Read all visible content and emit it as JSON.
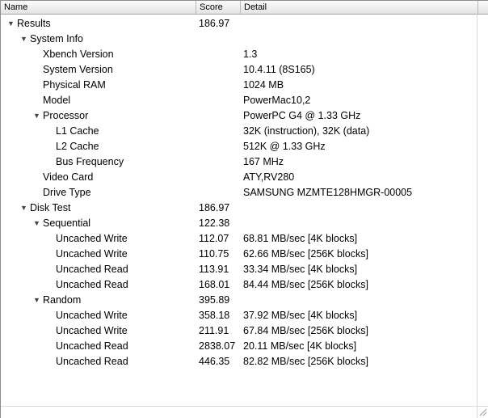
{
  "columns": {
    "name": "Name",
    "score": "Score",
    "detail": "Detail"
  },
  "rows": [
    {
      "name": "Results",
      "score": "186.97",
      "detail": "",
      "expanded": true
    },
    {
      "name": "System Info",
      "score": "",
      "detail": "",
      "expanded": true
    },
    {
      "name": "Xbench Version",
      "score": "",
      "detail": "1.3"
    },
    {
      "name": "System Version",
      "score": "",
      "detail": "10.4.11 (8S165)"
    },
    {
      "name": "Physical RAM",
      "score": "",
      "detail": "1024 MB"
    },
    {
      "name": "Model",
      "score": "",
      "detail": "PowerMac10,2"
    },
    {
      "name": "Processor",
      "score": "",
      "detail": "PowerPC G4 @ 1.33 GHz",
      "expanded": true
    },
    {
      "name": "L1 Cache",
      "score": "",
      "detail": "32K (instruction), 32K (data)"
    },
    {
      "name": "L2 Cache",
      "score": "",
      "detail": "512K @ 1.33 GHz"
    },
    {
      "name": "Bus Frequency",
      "score": "",
      "detail": "167 MHz"
    },
    {
      "name": "Video Card",
      "score": "",
      "detail": "ATY,RV280"
    },
    {
      "name": "Drive Type",
      "score": "",
      "detail": "SAMSUNG MZMTE128HMGR-00005"
    },
    {
      "name": "Disk Test",
      "score": "186.97",
      "detail": "",
      "expanded": true
    },
    {
      "name": "Sequential",
      "score": "122.38",
      "detail": "",
      "expanded": true
    },
    {
      "name": "Uncached Write",
      "score": "112.07",
      "detail": "68.81 MB/sec [4K blocks]"
    },
    {
      "name": "Uncached Write",
      "score": "110.75",
      "detail": "62.66 MB/sec [256K blocks]"
    },
    {
      "name": "Uncached Read",
      "score": "113.91",
      "detail": "33.34 MB/sec [4K blocks]"
    },
    {
      "name": "Uncached Read",
      "score": "168.01",
      "detail": "84.44 MB/sec [256K blocks]"
    },
    {
      "name": "Random",
      "score": "395.89",
      "detail": "",
      "expanded": true
    },
    {
      "name": "Uncached Write",
      "score": "358.18",
      "detail": "37.92 MB/sec [4K blocks]"
    },
    {
      "name": "Uncached Write",
      "score": "211.91",
      "detail": "67.84 MB/sec [256K blocks]"
    },
    {
      "name": "Uncached Read",
      "score": "2838.07",
      "detail": "20.11 MB/sec [4K blocks]"
    },
    {
      "name": "Uncached Read",
      "score": "446.35",
      "detail": "82.82 MB/sec [256K blocks]"
    }
  ]
}
